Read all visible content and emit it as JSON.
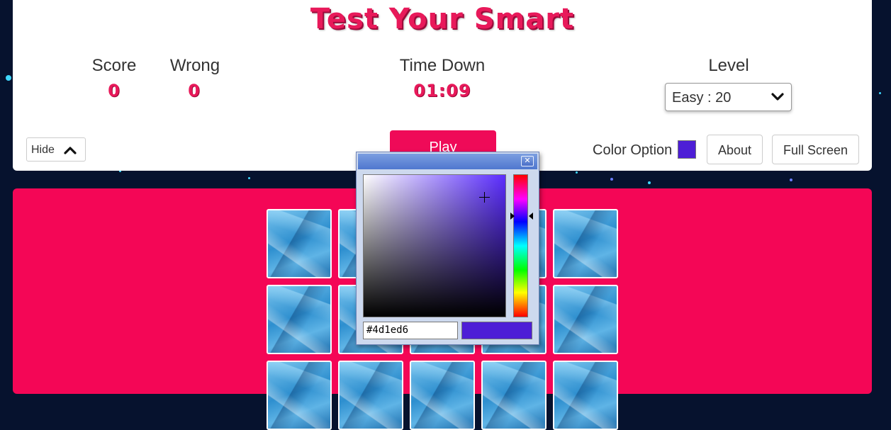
{
  "header": {
    "title": "Test Your Smart",
    "score_label": "Score",
    "score_value": "0",
    "wrong_label": "Wrong",
    "wrong_value": "0",
    "time_label": "Time Down",
    "time_value": "01:09",
    "level_label": "Level",
    "level_selected": "Easy : 20"
  },
  "controls": {
    "hide_label": "Hide",
    "play_label": "Play",
    "color_option_label": "Color Option",
    "about_label": "About",
    "fullscreen_label": "Full Screen"
  },
  "color_picker": {
    "hex_value": "#4d1ed6",
    "close_glyph": "✕"
  },
  "colors": {
    "accent": "#e8195a",
    "board": "#f40656",
    "selected_color": "#4d1ed6"
  },
  "icons": {
    "hide": "chevron-up-icon",
    "level": "chevron-down-icon",
    "close": "close-icon",
    "picker": "crosshair-icon"
  }
}
